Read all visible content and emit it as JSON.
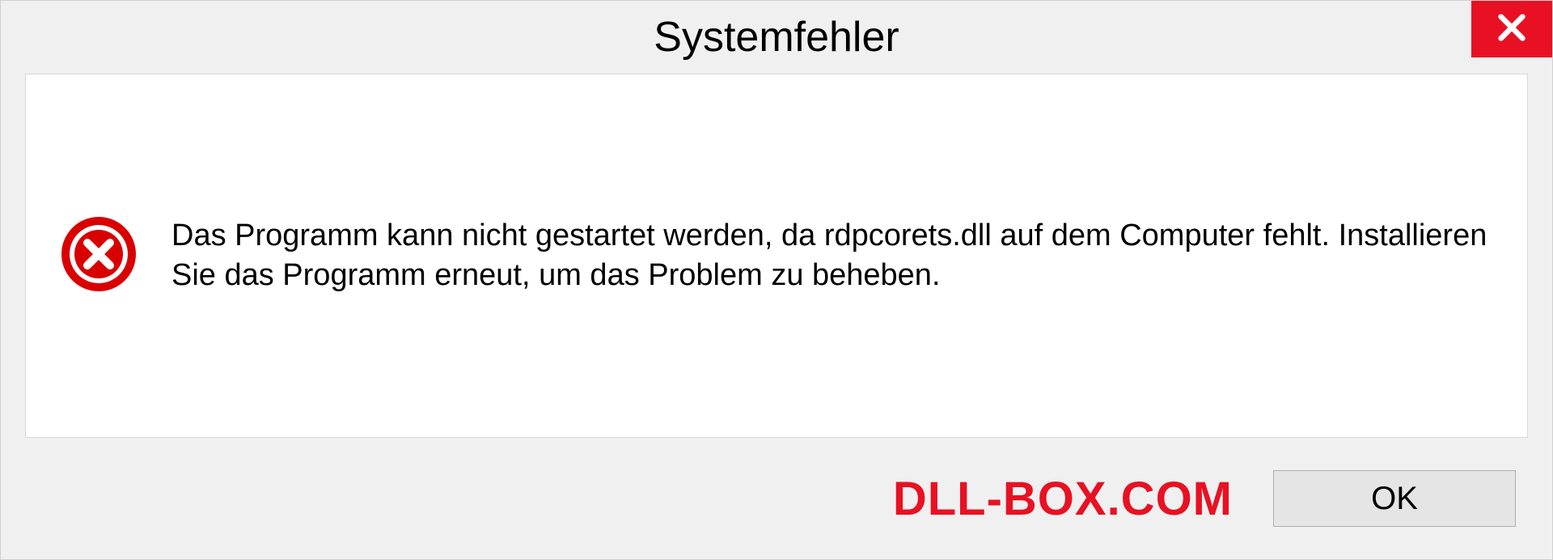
{
  "dialog": {
    "title": "Systemfehler",
    "message": "Das Programm kann nicht gestartet werden, da rdpcorets.dll auf dem Computer fehlt. Installieren Sie das Programm erneut, um das Problem zu beheben.",
    "ok_label": "OK"
  },
  "watermark": "DLL-BOX.COM",
  "colors": {
    "accent_red": "#e81123"
  }
}
